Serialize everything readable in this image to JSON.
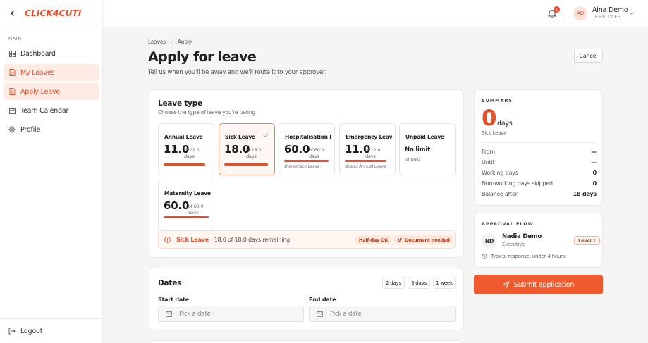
{
  "brand": {
    "logo_text": "CLICK4CUTI",
    "accent": "#e5502a"
  },
  "sidebar": {
    "section_label": "MAIN",
    "items": [
      {
        "label": "Dashboard",
        "icon": "grid-icon"
      },
      {
        "label": "My Leaves",
        "icon": "document-icon"
      },
      {
        "label": "Apply Leave",
        "icon": "document-edit-icon"
      },
      {
        "label": "Team Calendar",
        "icon": "calendar-icon"
      },
      {
        "label": "Profile",
        "icon": "gear-icon"
      }
    ],
    "logout_label": "Logout"
  },
  "topbar": {
    "notification_count": "1",
    "user": {
      "initials": "AD",
      "name": "Aina Demo",
      "role": "EMPLOYEE"
    }
  },
  "breadcrumb": {
    "parent": "Leaves",
    "current": "Apply"
  },
  "page": {
    "title": "Apply for leave",
    "subtitle": "Tell us when you'll be away and we'll route it to your approver.",
    "cancel_label": "Cancel"
  },
  "leave_type": {
    "title": "Leave type",
    "subtitle": "Choose the type of leave you're taking",
    "tiles": [
      {
        "name": "Annual Leave",
        "value": "11.0",
        "of_label": "of 12.0",
        "unit": "days",
        "used_fraction": 1.0
      },
      {
        "name": "Sick Leave",
        "value": "18.0",
        "of_label": "of 18.0",
        "unit": "days",
        "used_fraction": 1.0,
        "selected": true
      },
      {
        "name": "Hospitalisation Leave",
        "value": "60.0",
        "of_label": "of 60.0",
        "unit": "days",
        "used_fraction": 1.0,
        "shares": "shares Sick Leave"
      },
      {
        "name": "Emergency Leave",
        "value": "11.0",
        "of_label": "of 12.0",
        "unit": "days",
        "used_fraction": 1.0,
        "shares": "shares Annual Leave"
      },
      {
        "name": "Unpaid Leave",
        "value": "No limit",
        "sub": "Unpaid"
      },
      {
        "name": "Maternity Leave",
        "value": "60.0",
        "of_label": "of 60.0",
        "unit": "days",
        "used_fraction": 1.0
      }
    ],
    "info": {
      "type": "Sick Leave",
      "text": "· 18.0 of 18.0 days remaining",
      "pill_halfday": "Half-day OK",
      "pill_document": "Document needed"
    }
  },
  "dates": {
    "title": "Dates",
    "quick": [
      "2 days",
      "3 days",
      "1 week"
    ],
    "start_label": "Start date",
    "end_label": "End date",
    "start_placeholder": "Pick a date",
    "end_placeholder": "Pick a date"
  },
  "summary": {
    "title": "SUMMARY",
    "days_value": "0",
    "days_word": "days",
    "leave_type": "Sick Leave",
    "rows": [
      {
        "label": "From",
        "value": "—"
      },
      {
        "label": "Until",
        "value": "—"
      },
      {
        "label": "Working days",
        "value": "0"
      },
      {
        "label": "Non-working days skipped",
        "value": "0"
      },
      {
        "label": "Balance after",
        "value": "18 days"
      }
    ]
  },
  "approval_flow": {
    "title": "APPROVAL FLOW",
    "approver": {
      "initials": "ND",
      "name": "Nadia Demo",
      "role": "Executive",
      "level": "Level 1"
    },
    "response_text": "Typical response: under 4 hours"
  },
  "submit_label": "Submit application"
}
